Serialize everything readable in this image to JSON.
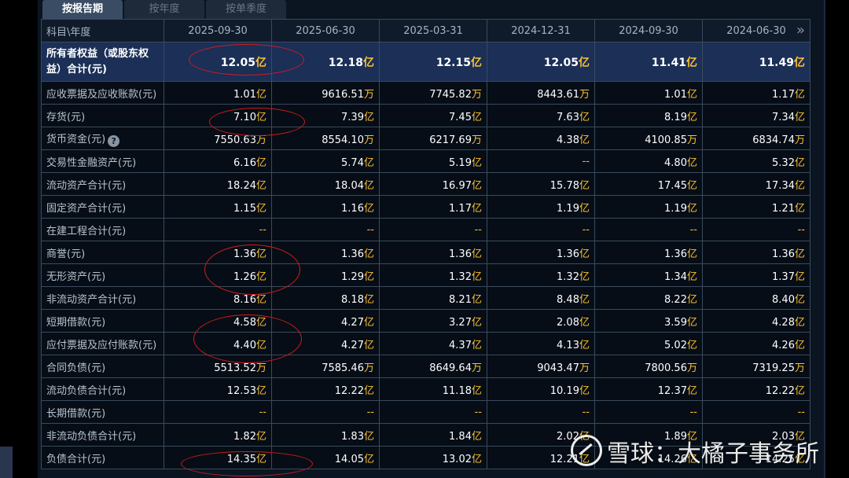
{
  "tabs": [
    {
      "label": "按报告期",
      "active": true
    },
    {
      "label": "按年度",
      "active": false
    },
    {
      "label": "按单季度",
      "active": false
    }
  ],
  "table": {
    "header_label": "科目\\年度",
    "columns": [
      "2025-09-30",
      "2025-06-30",
      "2025-03-31",
      "2024-12-31",
      "2024-09-30",
      "2024-06-30"
    ],
    "rows": [
      {
        "label": "所有者权益（或股东权益）合计(元)",
        "values": [
          [
            "12.05",
            "亿"
          ],
          [
            "12.18",
            "亿"
          ],
          [
            "12.15",
            "亿"
          ],
          [
            "12.05",
            "亿"
          ],
          [
            "11.41",
            "亿"
          ],
          [
            "11.49",
            "亿"
          ]
        ]
      },
      {
        "label": "应收票据及应收账款(元)",
        "values": [
          [
            "1.01",
            "亿"
          ],
          [
            "9616.51",
            "万"
          ],
          [
            "7745.82",
            "万"
          ],
          [
            "8443.61",
            "万"
          ],
          [
            "1.01",
            "亿"
          ],
          [
            "1.17",
            "亿"
          ]
        ]
      },
      {
        "label": "存货(元)",
        "values": [
          [
            "7.10",
            "亿"
          ],
          [
            "7.39",
            "亿"
          ],
          [
            "7.45",
            "亿"
          ],
          [
            "7.63",
            "亿"
          ],
          [
            "8.19",
            "亿"
          ],
          [
            "7.34",
            "亿"
          ]
        ]
      },
      {
        "label": "货币资金(元)",
        "help": true,
        "values": [
          [
            "7550.63",
            "万"
          ],
          [
            "8554.10",
            "万"
          ],
          [
            "6217.69",
            "万"
          ],
          [
            "4.38",
            "亿"
          ],
          [
            "4100.85",
            "万"
          ],
          [
            "6834.74",
            "万"
          ]
        ]
      },
      {
        "label": "交易性金融资产(元)",
        "values": [
          [
            "6.16",
            "亿"
          ],
          [
            "5.74",
            "亿"
          ],
          [
            "5.19",
            "亿"
          ],
          [
            "",
            "--"
          ],
          [
            "4.80",
            "亿"
          ],
          [
            "5.32",
            "亿"
          ]
        ]
      },
      {
        "label": "流动资产合计(元)",
        "values": [
          [
            "18.24",
            "亿"
          ],
          [
            "18.04",
            "亿"
          ],
          [
            "16.97",
            "亿"
          ],
          [
            "15.78",
            "亿"
          ],
          [
            "17.45",
            "亿"
          ],
          [
            "17.34",
            "亿"
          ]
        ]
      },
      {
        "label": "固定资产合计(元)",
        "values": [
          [
            "1.15",
            "亿"
          ],
          [
            "1.16",
            "亿"
          ],
          [
            "1.17",
            "亿"
          ],
          [
            "1.19",
            "亿"
          ],
          [
            "1.19",
            "亿"
          ],
          [
            "1.21",
            "亿"
          ]
        ]
      },
      {
        "label": "在建工程合计(元)",
        "values": [
          [
            "",
            "--"
          ],
          [
            "",
            "--"
          ],
          [
            "",
            "--"
          ],
          [
            "",
            "--"
          ],
          [
            "",
            "--"
          ],
          [
            "",
            "--"
          ]
        ]
      },
      {
        "label": "商誉(元)",
        "values": [
          [
            "1.36",
            "亿"
          ],
          [
            "1.36",
            "亿"
          ],
          [
            "1.36",
            "亿"
          ],
          [
            "1.36",
            "亿"
          ],
          [
            "1.36",
            "亿"
          ],
          [
            "1.36",
            "亿"
          ]
        ]
      },
      {
        "label": "无形资产(元)",
        "values": [
          [
            "1.26",
            "亿"
          ],
          [
            "1.29",
            "亿"
          ],
          [
            "1.32",
            "亿"
          ],
          [
            "1.32",
            "亿"
          ],
          [
            "1.34",
            "亿"
          ],
          [
            "1.37",
            "亿"
          ]
        ]
      },
      {
        "label": "非流动资产合计(元)",
        "values": [
          [
            "8.16",
            "亿"
          ],
          [
            "8.18",
            "亿"
          ],
          [
            "8.21",
            "亿"
          ],
          [
            "8.48",
            "亿"
          ],
          [
            "8.22",
            "亿"
          ],
          [
            "8.40",
            "亿"
          ]
        ]
      },
      {
        "label": "短期借款(元)",
        "values": [
          [
            "4.58",
            "亿"
          ],
          [
            "4.27",
            "亿"
          ],
          [
            "3.27",
            "亿"
          ],
          [
            "2.08",
            "亿"
          ],
          [
            "3.59",
            "亿"
          ],
          [
            "4.28",
            "亿"
          ]
        ]
      },
      {
        "label": "应付票据及应付账款(元)",
        "values": [
          [
            "4.40",
            "亿"
          ],
          [
            "4.27",
            "亿"
          ],
          [
            "4.37",
            "亿"
          ],
          [
            "4.13",
            "亿"
          ],
          [
            "5.02",
            "亿"
          ],
          [
            "4.26",
            "亿"
          ]
        ]
      },
      {
        "label": "合同负债(元)",
        "values": [
          [
            "5513.52",
            "万"
          ],
          [
            "7585.46",
            "万"
          ],
          [
            "8649.64",
            "万"
          ],
          [
            "9043.47",
            "万"
          ],
          [
            "7800.56",
            "万"
          ],
          [
            "7319.25",
            "万"
          ]
        ]
      },
      {
        "label": "流动负债合计(元)",
        "values": [
          [
            "12.53",
            "亿"
          ],
          [
            "12.22",
            "亿"
          ],
          [
            "11.18",
            "亿"
          ],
          [
            "10.19",
            "亿"
          ],
          [
            "12.37",
            "亿"
          ],
          [
            "12.22",
            "亿"
          ]
        ]
      },
      {
        "label": "长期借款(元)",
        "values": [
          [
            "",
            "--"
          ],
          [
            "",
            "--"
          ],
          [
            "",
            "--"
          ],
          [
            "",
            "--"
          ],
          [
            "",
            "--"
          ],
          [
            "",
            "--"
          ]
        ]
      },
      {
        "label": "非流动负债合计(元)",
        "values": [
          [
            "1.82",
            "亿"
          ],
          [
            "1.83",
            "亿"
          ],
          [
            "1.84",
            "亿"
          ],
          [
            "2.02",
            "亿"
          ],
          [
            "1.89",
            "亿"
          ],
          [
            "2.03",
            "亿"
          ]
        ]
      },
      {
        "label": "负债合计(元)",
        "values": [
          [
            "14.35",
            "亿"
          ],
          [
            "14.05",
            "亿"
          ],
          [
            "13.02",
            "亿"
          ],
          [
            "12.21",
            "亿"
          ],
          [
            "14.26",
            "亿"
          ],
          [
            "14.25",
            "亿"
          ]
        ]
      }
    ]
  },
  "watermark": "雪球：大橘子事务所",
  "colors": {
    "unit": "#ffc22e",
    "highlight_row": "#1b2f57",
    "annotation": "#d01c1c"
  }
}
